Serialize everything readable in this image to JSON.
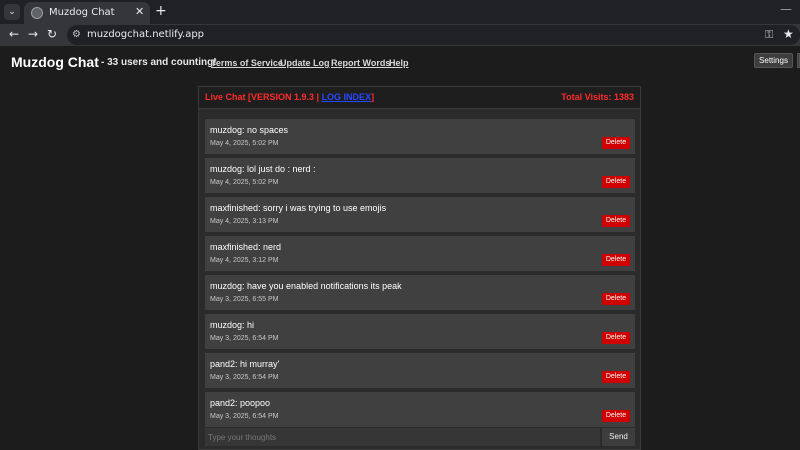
{
  "browser": {
    "tab_title": "Muzdog Chat",
    "tab_close": "✕",
    "new_tab": "+",
    "url": "muzdogchat.netlify.app"
  },
  "header": {
    "site_title": "Muzdog Chat",
    "user_count": "- 33 users and counting!",
    "links": [
      "Terms of Service",
      "Update Log",
      "Report Words",
      "Help"
    ],
    "settings_label": "Settings"
  },
  "chat": {
    "title_prefix": "Live Chat [VERSION 1.9.3 | ",
    "logs_link": "LOG INDEX",
    "title_suffix": "]",
    "total_visits": "Total Visits: 1383",
    "messages": [
      {
        "text": "muzdog: no spaces",
        "time": "May 4, 2025, 5:02 PM"
      },
      {
        "text": "muzdog: lol just do : nerd :",
        "time": "May 4, 2025, 5:02 PM"
      },
      {
        "text": "maxfinished: sorry i was trying to use emojis",
        "time": "May 4, 2025, 3:13 PM"
      },
      {
        "text": "maxfinished: nerd",
        "time": "May 4, 2025, 3:12 PM"
      },
      {
        "text": "muzdog: have you enabled notifications its peak",
        "time": "May 3, 2025, 6:55 PM"
      },
      {
        "text": "muzdog: hi",
        "time": "May 3, 2025, 6:54 PM"
      },
      {
        "text": "pand2: hi murray'",
        "time": "May 3, 2025, 6:54 PM"
      },
      {
        "text": "pand2: poopoo",
        "time": "May 3, 2025, 6:54 PM"
      }
    ],
    "delete_label": "Delete",
    "input_placeholder": "Type your thoughts",
    "send_label": "Send"
  },
  "colors": {
    "accent_red": "#ff2b2b",
    "link_blue": "#2848ff",
    "delete_red": "#d00000"
  },
  "icons": [
    "tab-dropdown-icon",
    "favicon-icon",
    "back-icon",
    "forward-icon",
    "reload-icon",
    "site-info-icon",
    "key-icon",
    "star-icon"
  ]
}
